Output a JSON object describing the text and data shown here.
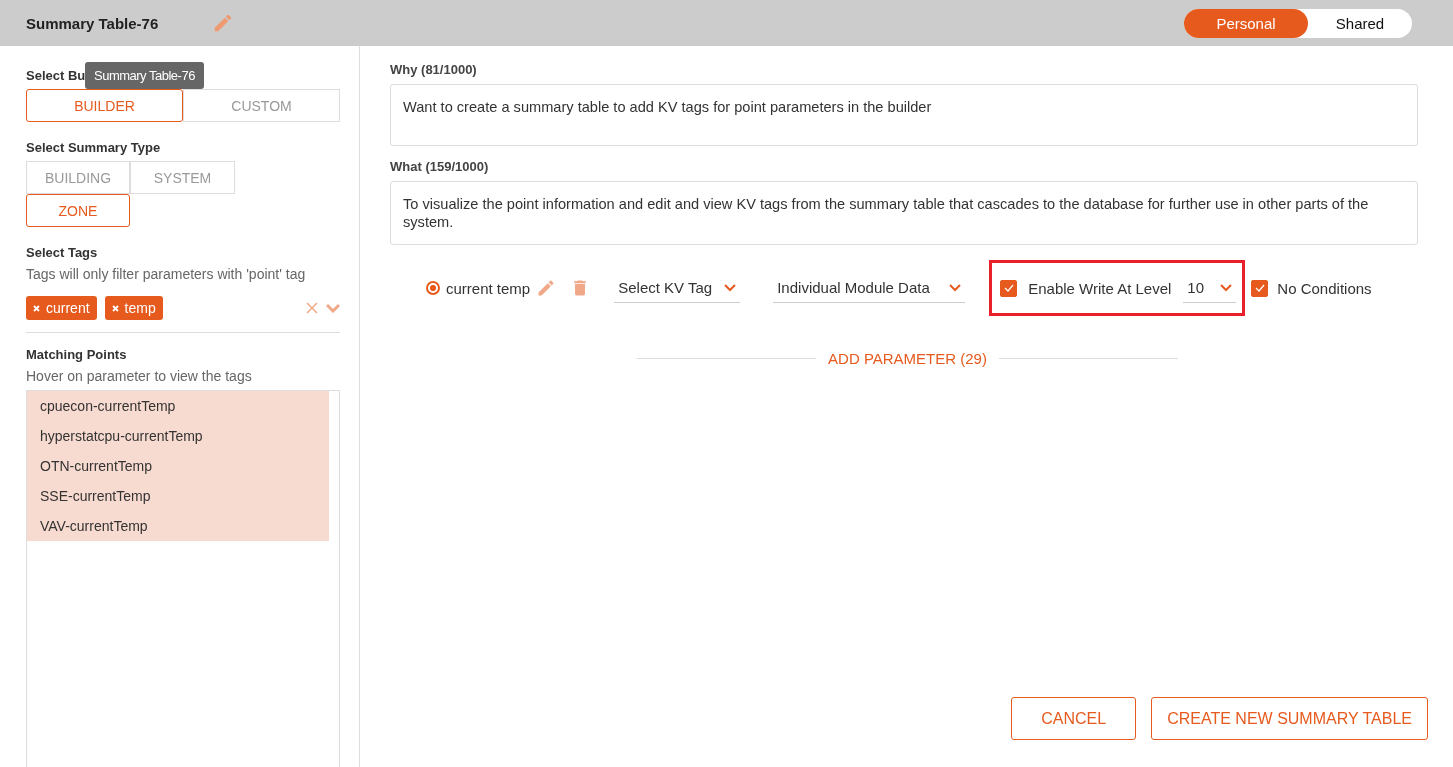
{
  "header": {
    "title": "Summary Table-76",
    "sharing": [
      {
        "label": "Personal",
        "selected": true
      },
      {
        "label": "Shared",
        "selected": false
      }
    ]
  },
  "tooltip": {
    "text": "Summary Table-76"
  },
  "build_type": {
    "label": "Select Bu",
    "options": [
      {
        "label": "BUILDER",
        "selected": true
      },
      {
        "label": "CUSTOM",
        "selected": false
      }
    ]
  },
  "summary_type": {
    "label": "Select Summary Type",
    "options": [
      {
        "label": "BUILDING",
        "selected": false
      },
      {
        "label": "SYSTEM",
        "selected": false
      },
      {
        "label": "ZONE",
        "selected": true
      }
    ]
  },
  "tags": {
    "label": "Select Tags",
    "hint": "Tags will only filter parameters with 'point' tag",
    "chips": [
      "current",
      "temp"
    ]
  },
  "matching_points": {
    "label": "Matching Points",
    "hint": "Hover on parameter to view the tags",
    "items": [
      {
        "label": "cpuecon-currentTemp",
        "selected": true
      },
      {
        "label": "hyperstatcpu-currentTemp",
        "selected": true
      },
      {
        "label": "OTN-currentTemp",
        "selected": true
      },
      {
        "label": "SSE-currentTemp",
        "selected": true
      },
      {
        "label": "VAV-currentTemp",
        "selected": true
      }
    ]
  },
  "why": {
    "label": "Why (81/1000)",
    "value": "Want to create a summary table to add KV tags for point parameters in the builder"
  },
  "what": {
    "label": "What (159/1000)",
    "value": "To visualize the point information and edit and view KV tags from the summary table that cascades to the database for further use in other parts of the system."
  },
  "parameter": {
    "name": "current temp",
    "selected": true,
    "kv_tag": {
      "placeholder": "Select KV Tag"
    },
    "data_source": "Individual Module Data",
    "enable_write": {
      "label": "Enable Write At Level",
      "checked": true,
      "level": "10",
      "highlighted": true
    },
    "no_conditions": {
      "label": "No Conditions",
      "checked": true
    }
  },
  "add_parameter": "ADD PARAMETER (29)",
  "buttons": [
    "CANCEL",
    "CREATE NEW SUMMARY TABLE"
  ]
}
